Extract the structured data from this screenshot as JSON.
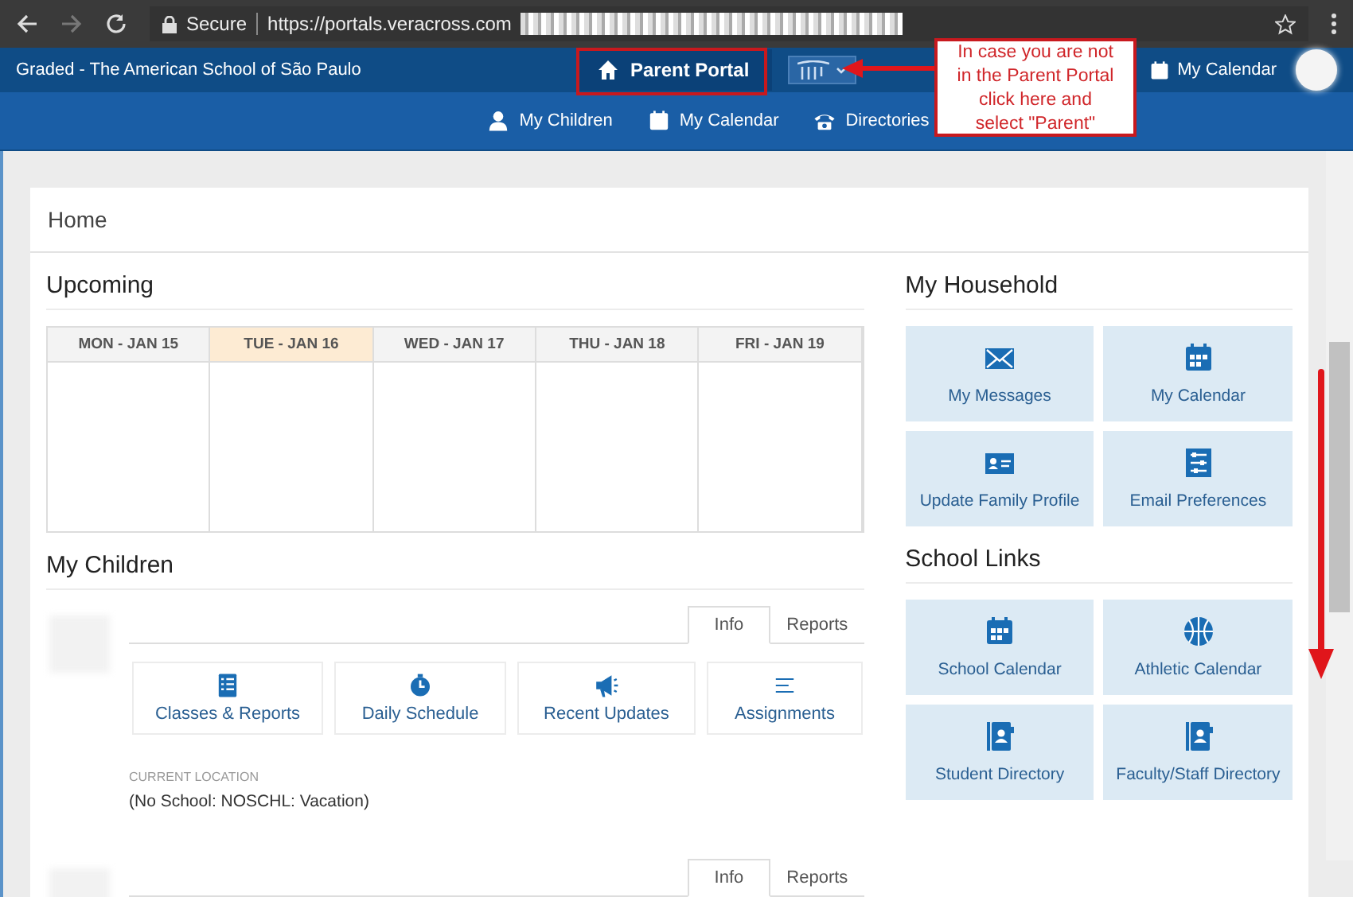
{
  "browser": {
    "secure_label": "Secure",
    "url": "https://portals.veracross.com"
  },
  "header": {
    "school_name": "Graded - The American School of São Paulo",
    "portal_button": "Parent Portal",
    "calendar_link": "My Calendar"
  },
  "nav": [
    {
      "label": "My Children",
      "kind": "person"
    },
    {
      "label": "My Calendar",
      "kind": "calendar"
    },
    {
      "label": "Directories",
      "kind": "phone"
    }
  ],
  "breadcrumb": "Home",
  "upcoming": {
    "title": "Upcoming",
    "days": [
      {
        "label": "MON - JAN 15",
        "today": false
      },
      {
        "label": "TUE - JAN 16",
        "today": true
      },
      {
        "label": "WED - JAN 17",
        "today": false
      },
      {
        "label": "THU - JAN 18",
        "today": false
      },
      {
        "label": "FRI - JAN 19",
        "today": false
      }
    ]
  },
  "children_section": {
    "title": "My Children",
    "children": [
      {
        "tabs": [
          {
            "label": "Info",
            "selected": true
          },
          {
            "label": "Reports",
            "selected": false
          }
        ],
        "actions": [
          {
            "label": "Classes & Reports",
            "kind": "checklist"
          },
          {
            "label": "Daily Schedule",
            "kind": "stopwatch"
          },
          {
            "label": "Recent Updates",
            "kind": "megaphone"
          },
          {
            "label": "Assignments",
            "kind": "lines"
          }
        ],
        "location_label": "CURRENT LOCATION",
        "location": "(No School: NOSCHL: Vacation)"
      },
      {
        "tabs": [
          {
            "label": "Info",
            "selected": true
          },
          {
            "label": "Reports",
            "selected": false
          }
        ]
      }
    ]
  },
  "household": {
    "title": "My Household",
    "tiles": [
      {
        "label": "My Messages",
        "kind": "envelope"
      },
      {
        "label": "My Calendar",
        "kind": "calendar"
      },
      {
        "label": "Update Family Profile",
        "kind": "idcard"
      },
      {
        "label": "Email Preferences",
        "kind": "sliders"
      }
    ]
  },
  "school_links": {
    "title": "School Links",
    "tiles": [
      {
        "label": "School Calendar",
        "kind": "calendar"
      },
      {
        "label": "Athletic Calendar",
        "kind": "ball"
      },
      {
        "label": "Student Directory",
        "kind": "book"
      },
      {
        "label": "Faculty/Staff Directory",
        "kind": "book"
      }
    ]
  },
  "annotation": {
    "callout": "In case you are not\nin the Parent Portal\nclick here and\nselect \"Parent\""
  }
}
